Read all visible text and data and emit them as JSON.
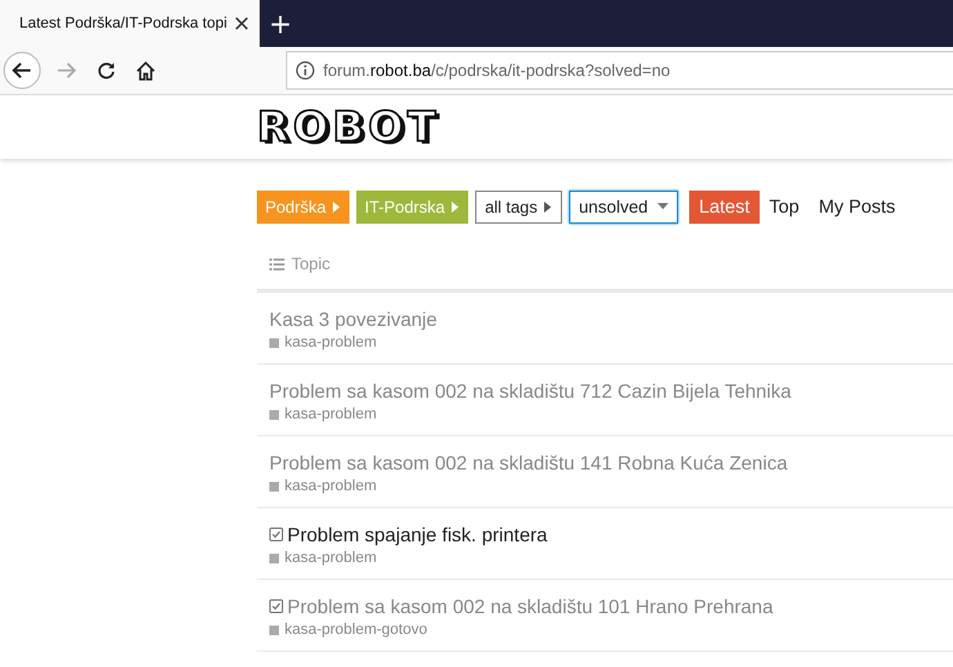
{
  "browser": {
    "tab_title": "Latest Podrška/IT-Podrska topi",
    "new_tab": "+",
    "url_host_pre": "forum.",
    "url_host_bold": "robot.ba",
    "url_path": "/c/podrska/it-podrska?solved=no"
  },
  "header": {
    "logo": "ROBOT"
  },
  "nav": {
    "breadcrumbs": [
      {
        "label": "Podrška",
        "color": "#f7941d"
      },
      {
        "label": "IT-Podrska",
        "color": "#9eb83b"
      },
      {
        "label": "all tags",
        "color": "#ffffff"
      }
    ],
    "filter": {
      "label": "unsolved",
      "focused": true
    },
    "tabs": [
      {
        "label": "Latest",
        "selected": true
      },
      {
        "label": "Top",
        "selected": false
      },
      {
        "label": "My Posts",
        "selected": false
      }
    ]
  },
  "table": {
    "column": "Topic",
    "rows": [
      {
        "title": "Kasa 3 povezivanje",
        "tag": "kasa-problem",
        "visited": true,
        "solved": false
      },
      {
        "title": "Problem sa kasom 002 na skladištu 712 Cazin Bijela Tehnika",
        "tag": "kasa-problem",
        "visited": true,
        "solved": false
      },
      {
        "title": "Problem sa kasom 002 na skladištu 141 Robna Kuća Zenica",
        "tag": "kasa-problem",
        "visited": true,
        "solved": false
      },
      {
        "title": "Problem spajanje fisk. printera",
        "tag": "kasa-problem",
        "visited": false,
        "solved": true
      },
      {
        "title": "Problem sa kasom 002 na skladištu 101 Hrano Prehrana",
        "tag": "kasa-problem-gotovo",
        "visited": true,
        "solved": true
      }
    ]
  }
}
